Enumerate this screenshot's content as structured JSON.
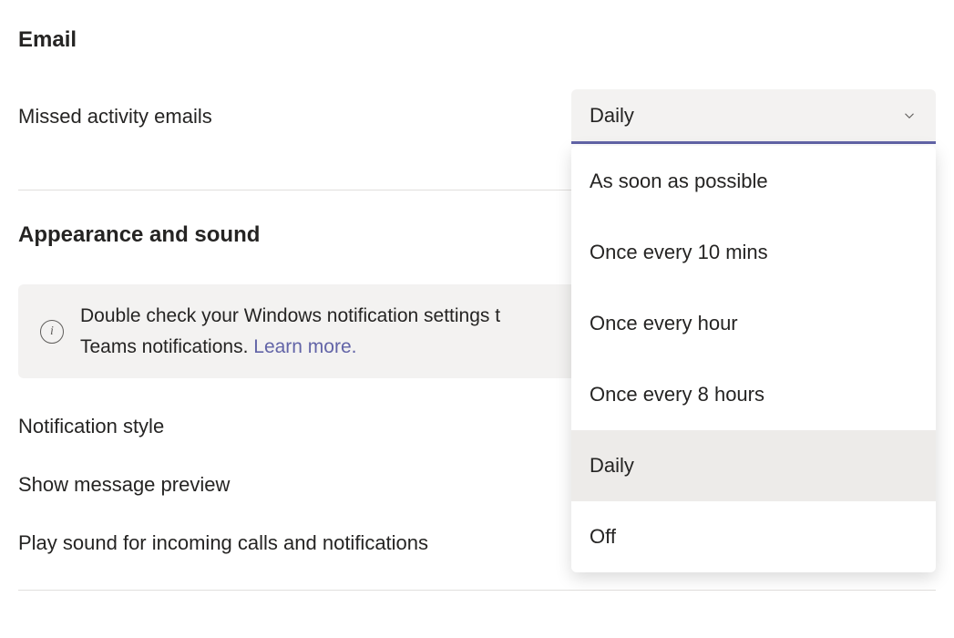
{
  "emailSection": {
    "heading": "Email",
    "missedActivity": {
      "label": "Missed activity emails",
      "selected": "Daily",
      "options": [
        "As soon as possible",
        "Once every 10 mins",
        "Once every hour",
        "Once every 8 hours",
        "Daily",
        "Off"
      ]
    }
  },
  "appearanceSection": {
    "heading": "Appearance and sound",
    "infoText": "Double check your Windows notification settings t",
    "infoTextLine2": "Teams notifications.",
    "learnMore": "Learn more.",
    "notificationStyle": "Notification style",
    "showMessagePreview": "Show message preview",
    "playSound": "Play sound for incoming calls and notifications"
  }
}
